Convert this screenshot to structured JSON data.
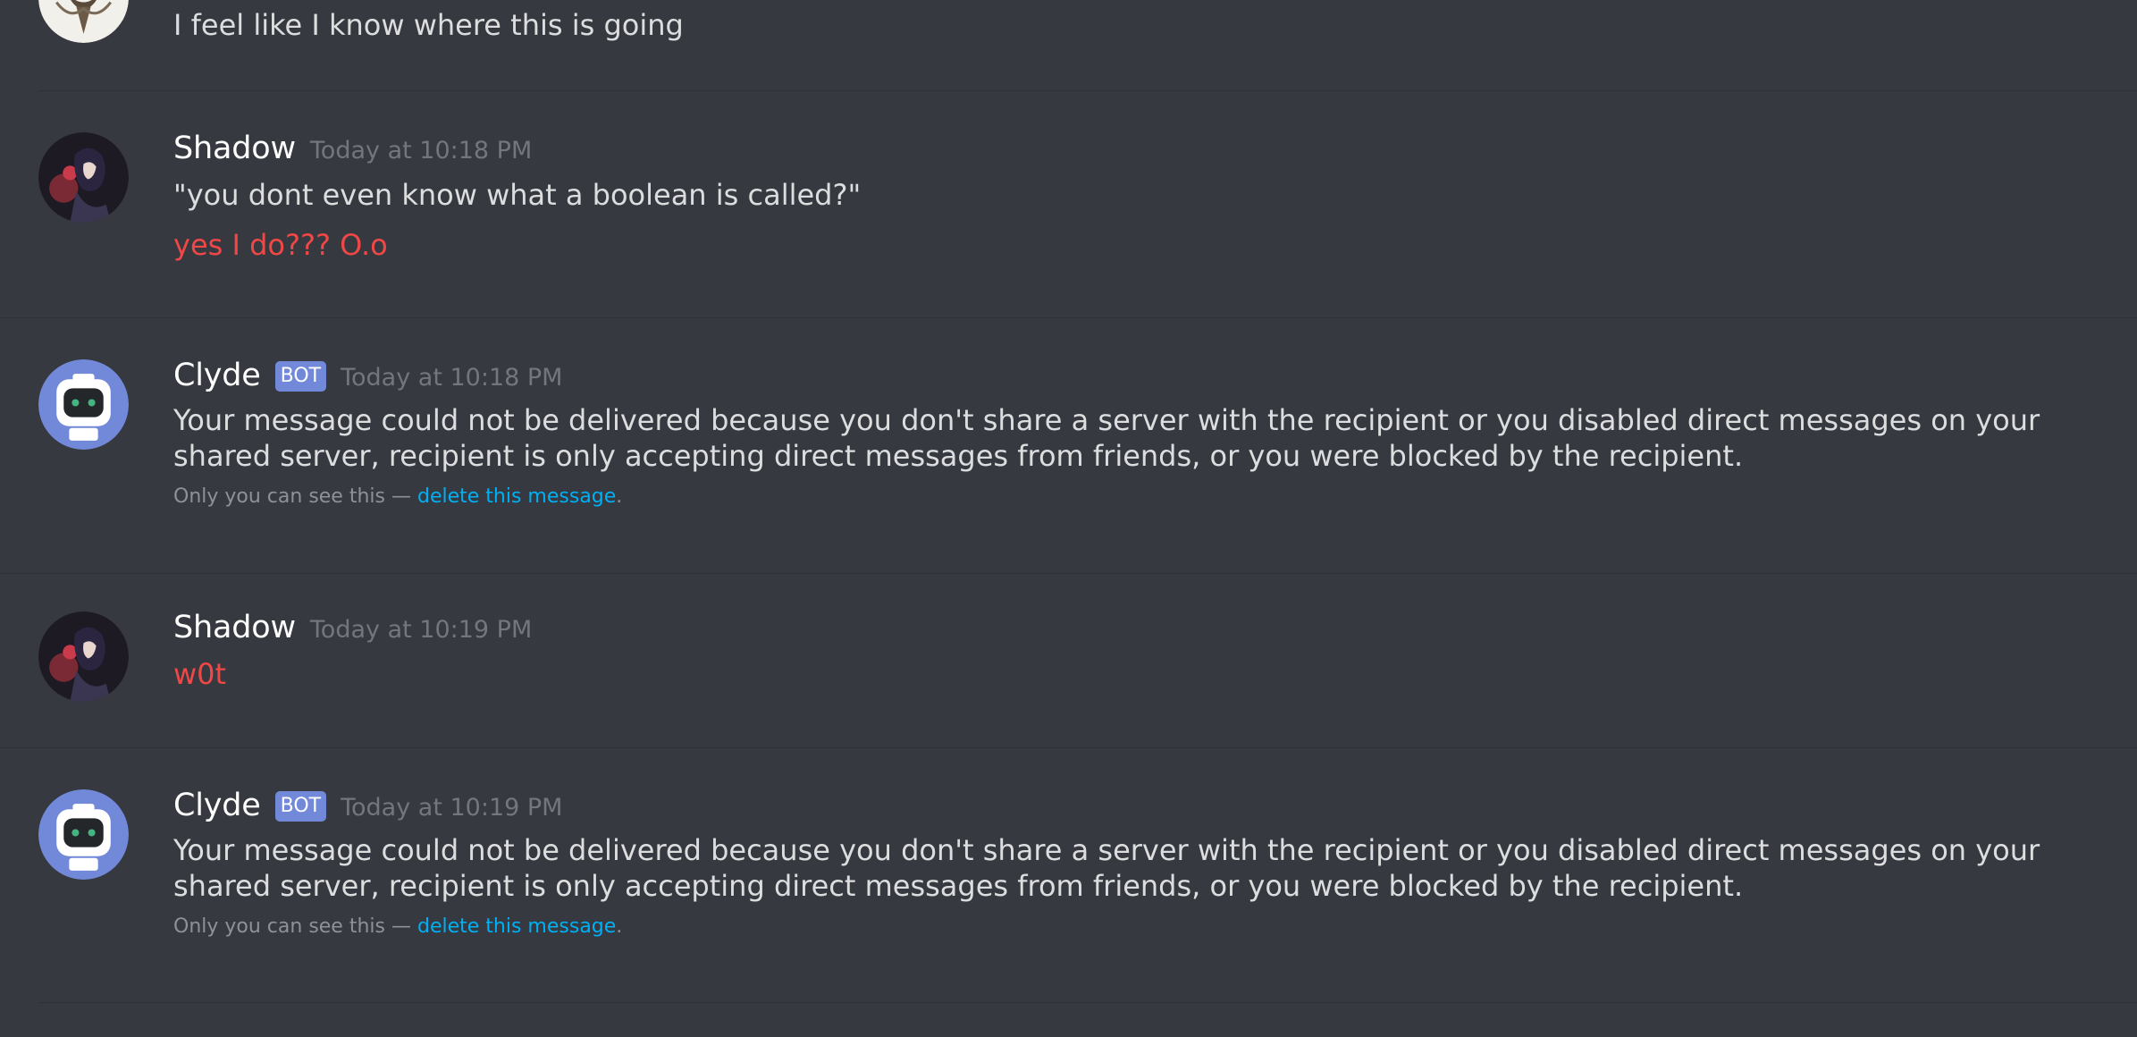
{
  "messages": [
    {
      "lines": [
        "I feel like I know where this is going"
      ]
    },
    {
      "username": "Shadow",
      "timestamp": "Today at 10:18 PM",
      "lines": [
        "\"you dont even know what a boolean is called?\"",
        "yes I do??? O.o"
      ]
    },
    {
      "username": "Clyde",
      "bot_label": "BOT",
      "timestamp": "Today at 10:18 PM",
      "text": "Your message could not be delivered because you don't share a server with the recipient or you disabled direct messages on your shared server, recipient is only accepting direct messages from friends, or you were blocked by the recipient.",
      "notice": "Only you can see this — ",
      "notice_link": "delete this message",
      "notice_end": "."
    },
    {
      "username": "Shadow",
      "timestamp": "Today at 10:19 PM",
      "lines": [
        "w0t"
      ]
    },
    {
      "username": "Clyde",
      "bot_label": "BOT",
      "timestamp": "Today at 10:19 PM",
      "text": "Your message could not be delivered because you don't share a server with the recipient or you disabled direct messages on your shared server, recipient is only accepting direct messages from friends, or you were blocked by the recipient.",
      "notice": "Only you can see this — ",
      "notice_link": "delete this message",
      "notice_end": "."
    }
  ],
  "colors": {
    "background": "#36393f",
    "error_text": "#f04747",
    "bot_tag": "#7289da",
    "link": "#00b0f4"
  },
  "icons": {
    "shadow_avatar": "anime-character-avatar",
    "clyde_avatar": "clyde-robot-avatar",
    "partial_avatar": "user-avatar"
  }
}
